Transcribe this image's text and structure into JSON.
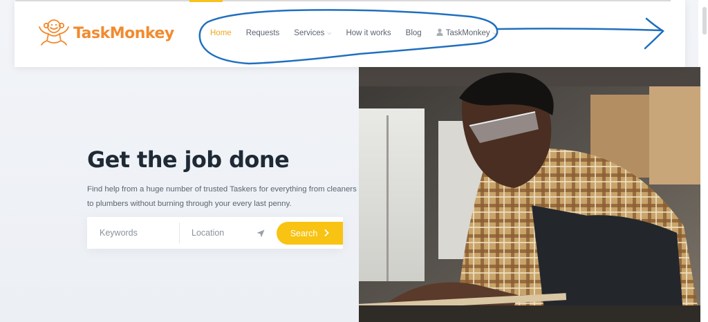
{
  "brand": {
    "name": "TaskMonkey",
    "logo_icon": "monkey-mascot-icon",
    "color": "#f28a2e"
  },
  "nav": {
    "items": [
      {
        "label": "Home",
        "active": true
      },
      {
        "label": "Requests",
        "active": false
      },
      {
        "label": "Services",
        "active": false,
        "has_dropdown": true
      },
      {
        "label": "How it works",
        "active": false
      },
      {
        "label": "Blog",
        "active": false
      },
      {
        "label": "TaskMonkey",
        "active": false,
        "has_dropdown": true,
        "icon": "user-icon"
      }
    ],
    "active_color": "#f2a51a",
    "text_color": "#5b6472"
  },
  "hero": {
    "title": "Get the job done",
    "description": "Find help from a huge number of trusted Taskers for everything from cleaners to plumbers without burning through your every last penny.",
    "image": "craftsman-working-wood-photo"
  },
  "search": {
    "keywords_placeholder": "Keywords",
    "location_placeholder": "Location",
    "locate_icon": "location-arrow-icon",
    "button_label": "Search",
    "button_icon": "chevron-right-icon",
    "button_color": "#f8c312"
  },
  "annotation": {
    "color": "#1f6fbf",
    "shape": "hand-drawn ellipse around navigation with arrow pointing right"
  }
}
